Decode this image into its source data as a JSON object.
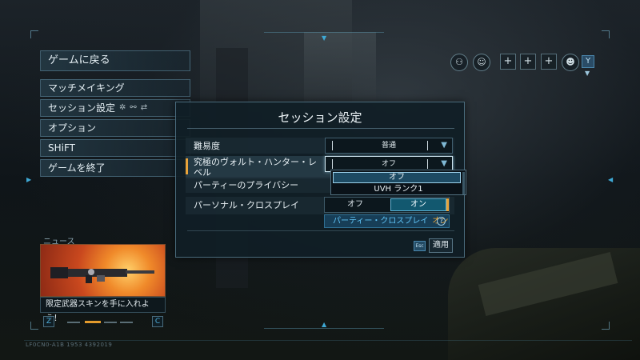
{
  "menu": {
    "back": "ゲームに戻る",
    "items": [
      "マッチメイキング",
      "セッション設定",
      "オプション",
      "SHiFT",
      "ゲームを終了"
    ]
  },
  "news": {
    "label": "ニュース",
    "caption": "限定武器スキンを手に入れよう！",
    "prev_key": "Z",
    "next_key": "C"
  },
  "build": "LF0CN0-A1B 1953 4392019",
  "top_right": {
    "y_key": "Y"
  },
  "dialog": {
    "title": "セッション設定",
    "rows": {
      "difficulty": {
        "label": "難易度",
        "value": "普通"
      },
      "uvh": {
        "label": "究極のヴォルト・ハンター・レベル",
        "value": "オフ"
      },
      "privacy": {
        "label": "パーティーのプライバシー"
      },
      "crossplay": {
        "label": "パーソナル・クロスプレイ",
        "off": "オフ",
        "on": "オン"
      }
    },
    "dropdown_options": [
      "オフ",
      "UVH ランク1"
    ],
    "party_crossplay": {
      "text": "パーティー・クロスプレイ",
      "state": "オン",
      "help": "?"
    },
    "esc_key": "Esc",
    "apply": "適用"
  },
  "colors": {
    "accent_orange": "#e8a33a",
    "accent_blue": "#3ea8d4",
    "panel": "#101e26"
  }
}
